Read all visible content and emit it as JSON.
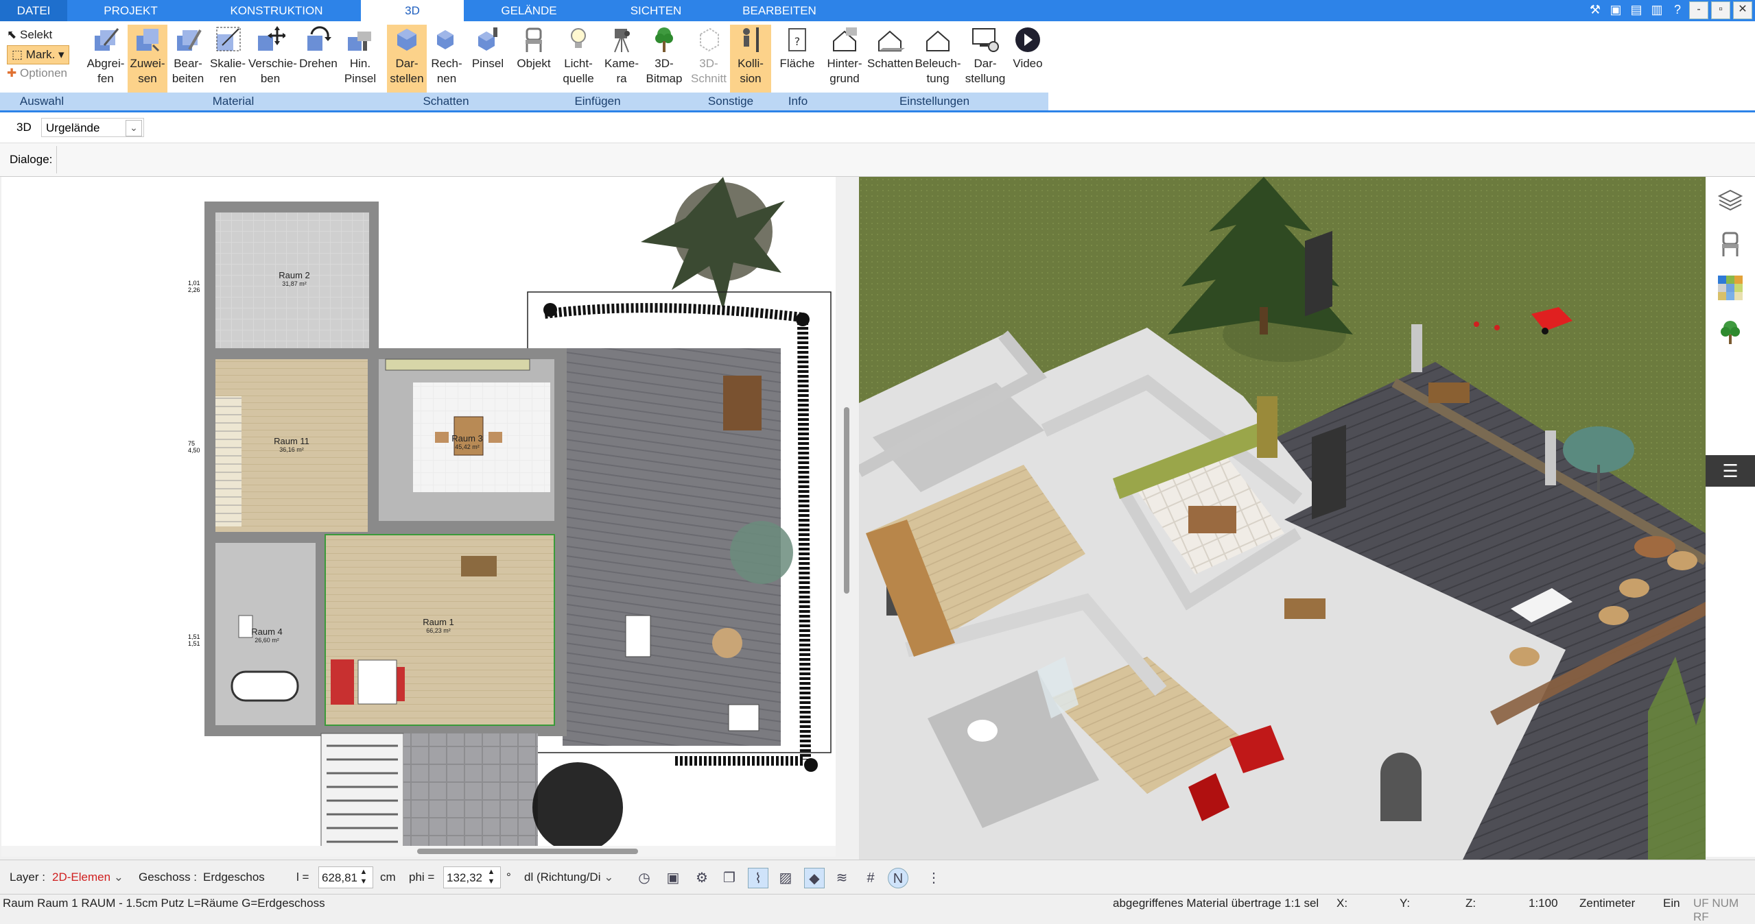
{
  "menubar": {
    "tabs": [
      {
        "label": "DATEI"
      },
      {
        "label": "PROJEKT"
      },
      {
        "label": "KONSTRUKTION"
      },
      {
        "label": "3D"
      },
      {
        "label": "GELÄNDE"
      },
      {
        "label": "SICHTEN"
      },
      {
        "label": "BEARBEITEN"
      }
    ],
    "window_buttons": {
      "minimize": "-",
      "restore": "▫",
      "close": "✕"
    }
  },
  "ribbon": {
    "auswahl": {
      "selekt": "Selekt",
      "mark": "Mark.",
      "optionen": "Optionen",
      "group": "Auswahl"
    },
    "material": {
      "group": "Material",
      "buttons": [
        {
          "label": "Abgrei-\nfen"
        },
        {
          "label": "Zuwei-\nsen"
        },
        {
          "label": "Bear-\nbeiten"
        },
        {
          "label": "Skalie-\nren"
        },
        {
          "label": "Verschie-\nben"
        },
        {
          "label": "Drehen"
        },
        {
          "label": "Hin.\nPinsel"
        }
      ]
    },
    "schatten": {
      "group": "Schatten",
      "buttons": [
        {
          "label": "Dar-\nstellen"
        },
        {
          "label": "Rech-\nnen"
        },
        {
          "label": "Pinsel"
        }
      ]
    },
    "einfuegen": {
      "group": "Einfügen",
      "buttons": [
        {
          "label": "Objekt"
        },
        {
          "label": "Licht-\nquelle"
        },
        {
          "label": "Kame-\nra"
        },
        {
          "label": "3D-\nBitmap"
        }
      ]
    },
    "sonstige": {
      "group": "Sonstige",
      "buttons": [
        {
          "label": "3D-\nSchnitt"
        },
        {
          "label": "Kolli-\nsion"
        }
      ]
    },
    "info": {
      "group": "Info",
      "buttons": [
        {
          "label": "Fläche"
        }
      ]
    },
    "einstellungen": {
      "group": "Einstellungen",
      "buttons": [
        {
          "label": "Hinter-\ngrund"
        },
        {
          "label": "Schatten"
        },
        {
          "label": "Beleuch-\ntung"
        },
        {
          "label": "Dar-\nstellung"
        },
        {
          "label": "Video"
        }
      ]
    }
  },
  "toolbar3d": {
    "label": "3D",
    "select_value": "Urgelände"
  },
  "dialoge": {
    "label": "Dialoge:"
  },
  "plan": {
    "rooms": [
      {
        "name": "Raum 2",
        "area": "31,87 m²"
      },
      {
        "name": "Raum 11",
        "area": "36,16 m²"
      },
      {
        "name": "Raum 3",
        "area": "45,42 m²"
      },
      {
        "name": "Raum 4",
        "area": "26,60 m²"
      },
      {
        "name": "Raum 1",
        "area": "66,23 m²"
      }
    ],
    "dims": [
      "1,01",
      "2,26",
      "75",
      "4,50",
      "1,51",
      "1,51"
    ]
  },
  "statusbar": {
    "layer_label": "Layer :",
    "layer_value": "2D-Elemen",
    "geschoss_label": "Geschoss :",
    "geschoss_value": "Erdgeschos",
    "l_label": "l =",
    "l_value": "628,81",
    "l_unit": "cm",
    "phi_label": "phi =",
    "phi_value": "132,32",
    "phi_unit": "°",
    "dl_value": "dl (Richtung/Di"
  },
  "infobar": {
    "left": "Raum Raum 1 RAUM - 1.5cm Putz L=Räume G=Erdgeschoss",
    "message": "abgegriffenes Material übertrage 1:1 sel",
    "x": "X:",
    "y": "Y:",
    "z": "Z:",
    "scale": "1:100",
    "unit": "Zentimeter",
    "mode": "Ein",
    "flags": "UF NUM RF"
  },
  "colors": {
    "accent": "#2d83e8",
    "ribbon_group": "#bcd7f5",
    "active_button": "#fcd28a",
    "grass": "#6e7d3f",
    "deck": "#4f4f57",
    "floor_wood": "#d8c6a0"
  }
}
